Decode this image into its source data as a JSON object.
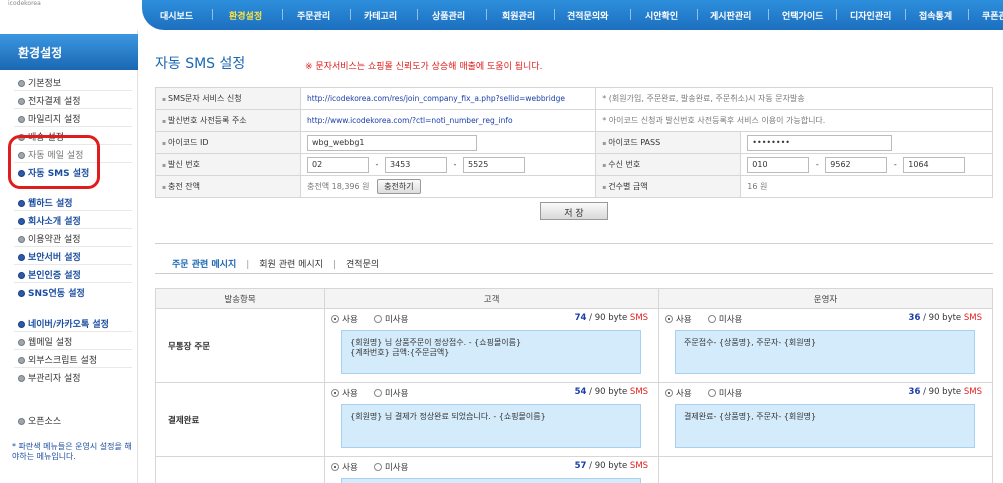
{
  "header": {
    "logo_sub": "icodekorea",
    "nav": [
      "대시보드",
      "환경설정",
      "주문관리",
      "카테고리",
      "상품관리",
      "회원관리",
      "견적문의와",
      "시안확인",
      "게시판관리",
      "언택가이드",
      "디자인관리",
      "접속통계",
      "쿠폰관"
    ]
  },
  "sidebar": {
    "title": "환경설정",
    "group1": [
      "기본정보",
      "전자결제 설정",
      "마일리지 설정",
      "배송 설정",
      "자동 메일 설정",
      "자동 SMS 설정"
    ],
    "group2": [
      "웹하드 설정",
      "회사소개 설정",
      "이용약관 설정",
      "보안서버 설정",
      "본인인증 설정",
      "SNS연동 설정"
    ],
    "group3": [
      "네이버/카카오톡 설정",
      "웹메일 설정",
      "외부스크립트 설정",
      "부관리자 설정"
    ],
    "open_source": "오픈소스",
    "note": "* 파란색 메뉴들은 운영시 설정을 해야하는 메뉴입니다."
  },
  "main": {
    "title": "자동 SMS 설정",
    "notice": "※ 문자서비스는 쇼핑몰 신뢰도가 상승해 매출에 도움이 됩니다.",
    "form": {
      "apply_label": "SMS문자 서비스 신청",
      "apply_link": "http://icodekorea.com/res/join_company_fix_a.php?sellid=webbridge",
      "apply_desc": "* (회원가입, 주문완료, 발송완료, 주문취소)시 자동 문자발송",
      "sender_reg_label": "발신번호 사전등록 주소",
      "sender_reg_link": "http://www.icodekorea.com/?ctl=noti_number_reg_info",
      "sender_reg_desc": "* 아이코드 신청과 발신번호 사전등록후 서비스 이용이 가능합니다.",
      "id_label": "아이코드 ID",
      "id_value": "wbg_webbg1",
      "pass_label": "아이코드 PASS",
      "pass_value": "••••••••",
      "send_no_label": "발신 번호",
      "send_no": [
        "02",
        "3453",
        "5525"
      ],
      "recv_no_label": "수신 번호",
      "recv_no": [
        "010",
        "9562",
        "1064"
      ],
      "balance_label": "충전 잔액",
      "balance_text": "충전액 18,396 원",
      "charge_button": "충전하기",
      "per_cost_label": "건수별 금액",
      "per_cost_value": "16 원"
    },
    "save_button": "저 장",
    "tabs": [
      "주문 관련 메시지",
      "회원 관련 메시지",
      "견적문의"
    ],
    "msg_table": {
      "col_item": "발송항목",
      "col_customer": "고객",
      "col_admin": "운영자",
      "use_label": "사용",
      "nouse_label": "미사용",
      "byte_suffix": "/ 90 byte",
      "sms_label": "SMS",
      "rows": [
        {
          "name": "무통장 주문",
          "cust_bytes": "74",
          "cust_msg_1": "{회원명} 님 상품주문이 정상접수. - {쇼핑몰이름}",
          "cust_msg_2": "{계좌번호} 금액:{주문금액}",
          "admin_bytes": "36",
          "admin_msg": "주문접수- {상품명}, 주문자- {회원명}"
        },
        {
          "name": "결제완료",
          "cust_bytes": "54",
          "cust_msg_1": "{회원명} 님 결제가 정상완료 되었습니다. - {쇼핑몰이름}",
          "cust_msg_2": "",
          "admin_bytes": "36",
          "admin_msg": "결제완료- {상품명}, 주문자- {회원명}"
        },
        {
          "name": "",
          "cust_bytes": "57",
          "cust_msg_1": "",
          "cust_msg_2": "",
          "admin_bytes": "",
          "admin_msg": ""
        }
      ]
    }
  }
}
